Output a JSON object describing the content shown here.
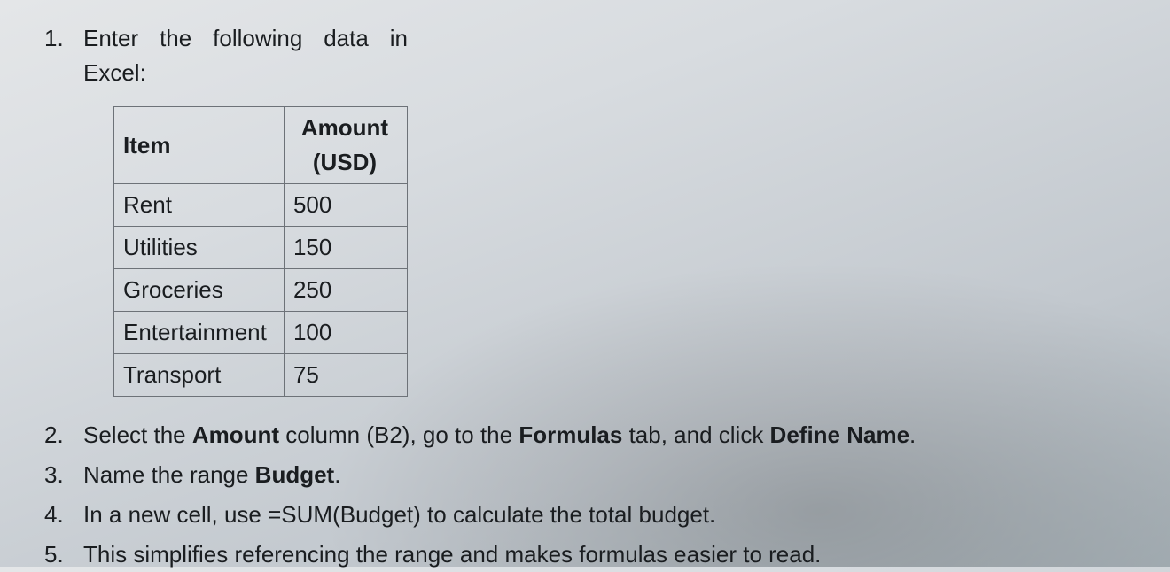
{
  "steps": {
    "s1": "Enter the following data in Excel:",
    "s2_pre": "Select the ",
    "s2_amount": "Amount",
    "s2_mid1": " column (B2), go to the ",
    "s2_formulas": "Formulas",
    "s2_mid2": " tab, and click ",
    "s2_define": "Define Name",
    "s2_end": ".",
    "s3_pre": "Name the range ",
    "s3_budget": "Budget",
    "s3_end": ".",
    "s4_pre": "In a new cell, use ",
    "s4_formula": "=SUM(Budget)",
    "s4_end": " to calculate the total budget.",
    "s5": "This simplifies referencing the range and makes formulas easier to read."
  },
  "table": {
    "headers": {
      "c1": "Item",
      "c2": "Amount (USD)"
    },
    "rows": [
      {
        "c1": "Rent",
        "c2": "500"
      },
      {
        "c1": "Utilities",
        "c2": "150"
      },
      {
        "c1": "Groceries",
        "c2": "250"
      },
      {
        "c1": "Entertainment",
        "c2": "100"
      },
      {
        "c1": "Transport",
        "c2": "75"
      }
    ]
  },
  "chart_data": {
    "type": "table",
    "title": "",
    "columns": [
      "Item",
      "Amount (USD)"
    ],
    "rows": [
      [
        "Rent",
        500
      ],
      [
        "Utilities",
        150
      ],
      [
        "Groceries",
        250
      ],
      [
        "Entertainment",
        100
      ],
      [
        "Transport",
        75
      ]
    ]
  }
}
